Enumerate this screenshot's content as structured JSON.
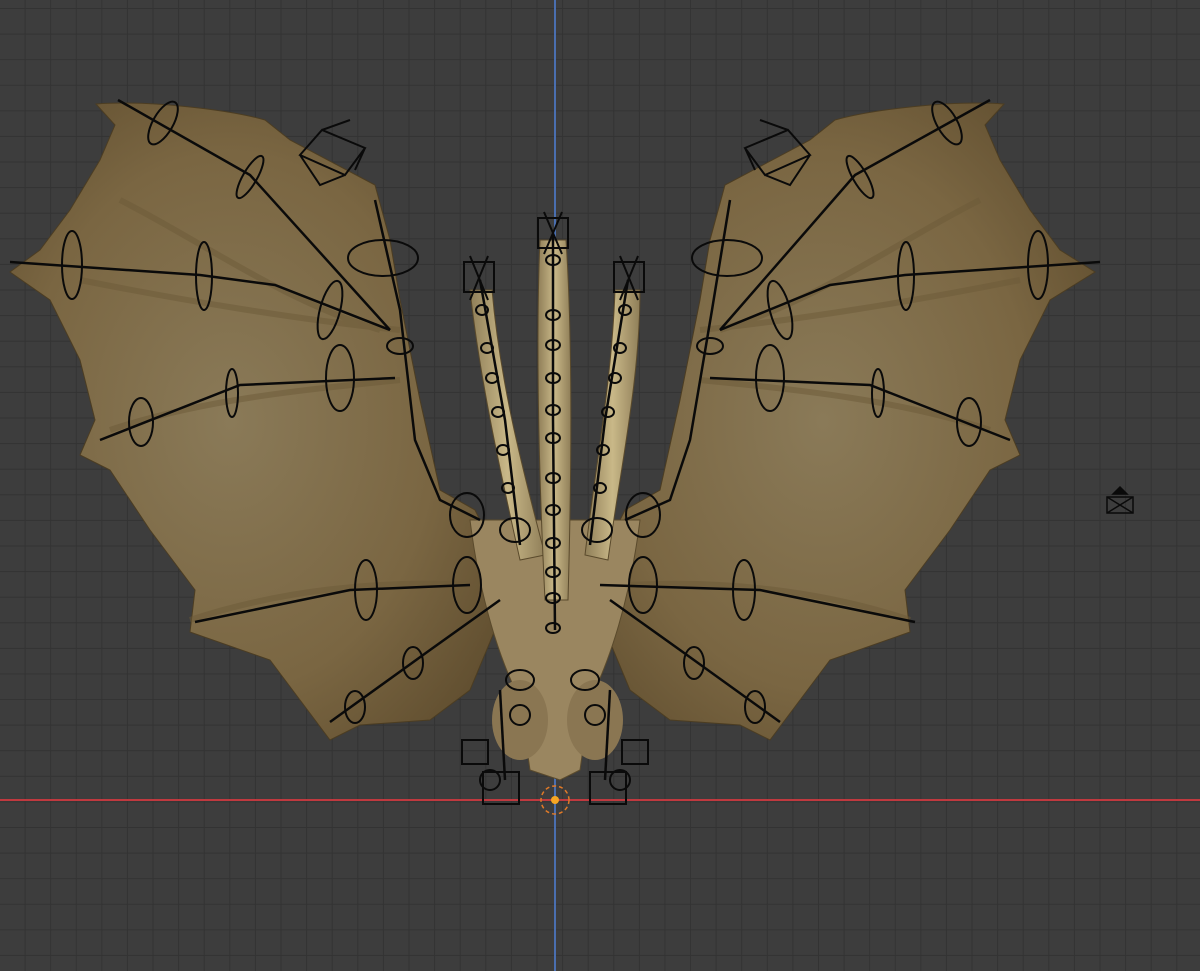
{
  "viewport": {
    "background": "#3d3d3d",
    "grid_color": "#333333",
    "x_axis_color": "#c0393f",
    "y_axis_color": "#4a6fb0",
    "origin_color": "#f5a623"
  },
  "objects": {
    "model": "dragon-mesh",
    "camera_icon": "camera-icon",
    "origin_icon": "origin-icon"
  }
}
